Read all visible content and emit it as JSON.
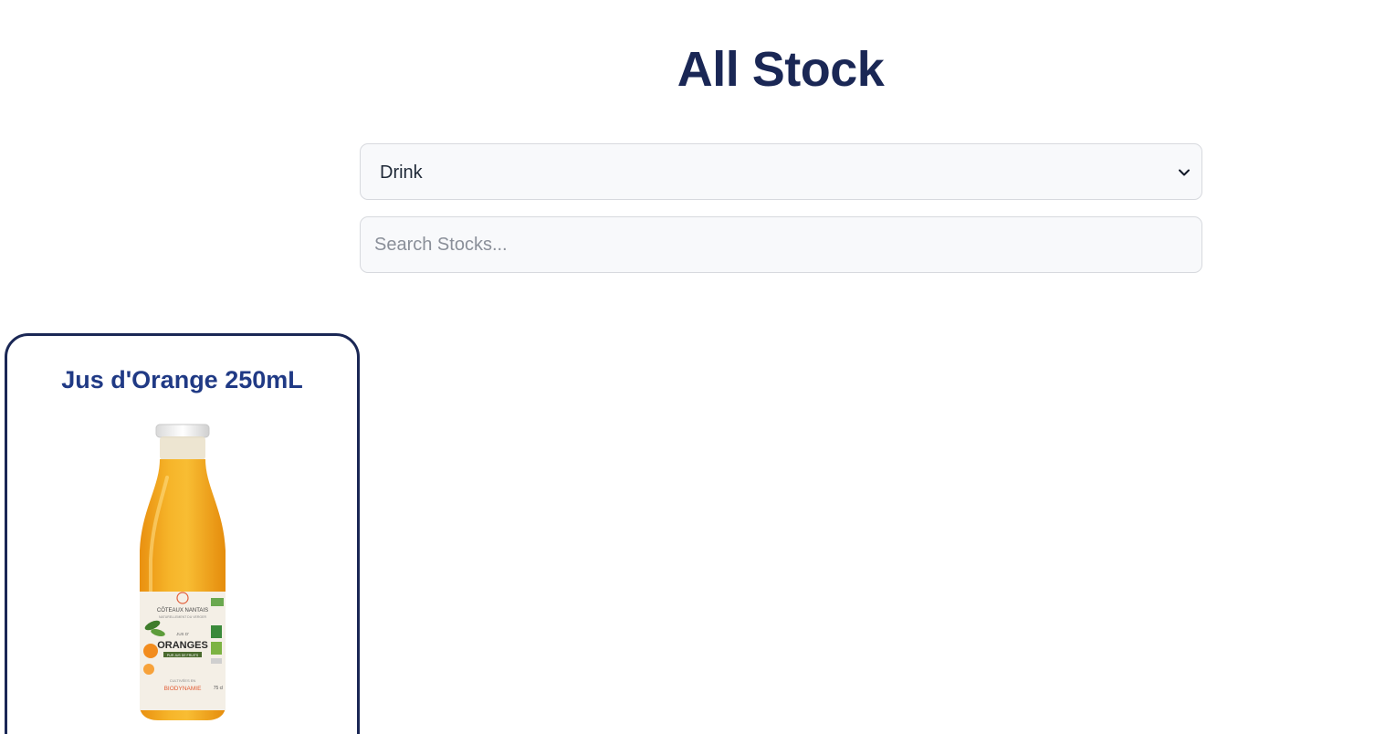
{
  "page": {
    "title": "All Stock"
  },
  "filters": {
    "category": {
      "selected": "Drink",
      "icon": "chevron-down-icon"
    },
    "search": {
      "value": "",
      "placeholder": "Search Stocks..."
    }
  },
  "products": [
    {
      "name": "Jus d'Orange 250mL",
      "image": {
        "label_brand": "CÔTEAUX NANTAIS",
        "label_tagline": "NATURELLEMENT DU VERGER",
        "label_small": "JUS D'",
        "label_main": "ORANGES",
        "label_sub": "PUR JUS DE FRUITS",
        "label_footer_small": "CULTIVÉES EN",
        "label_footer": "BIODYNAMIE",
        "label_volume": "75 cl",
        "juice_color": "#f4a81d",
        "label_color": "#f4efe6"
      }
    }
  ],
  "colors": {
    "title": "#1a2755",
    "product_name": "#203a85",
    "card_border": "#1a2755",
    "input_background": "#f8f9fb",
    "input_border": "#d7d9de"
  }
}
